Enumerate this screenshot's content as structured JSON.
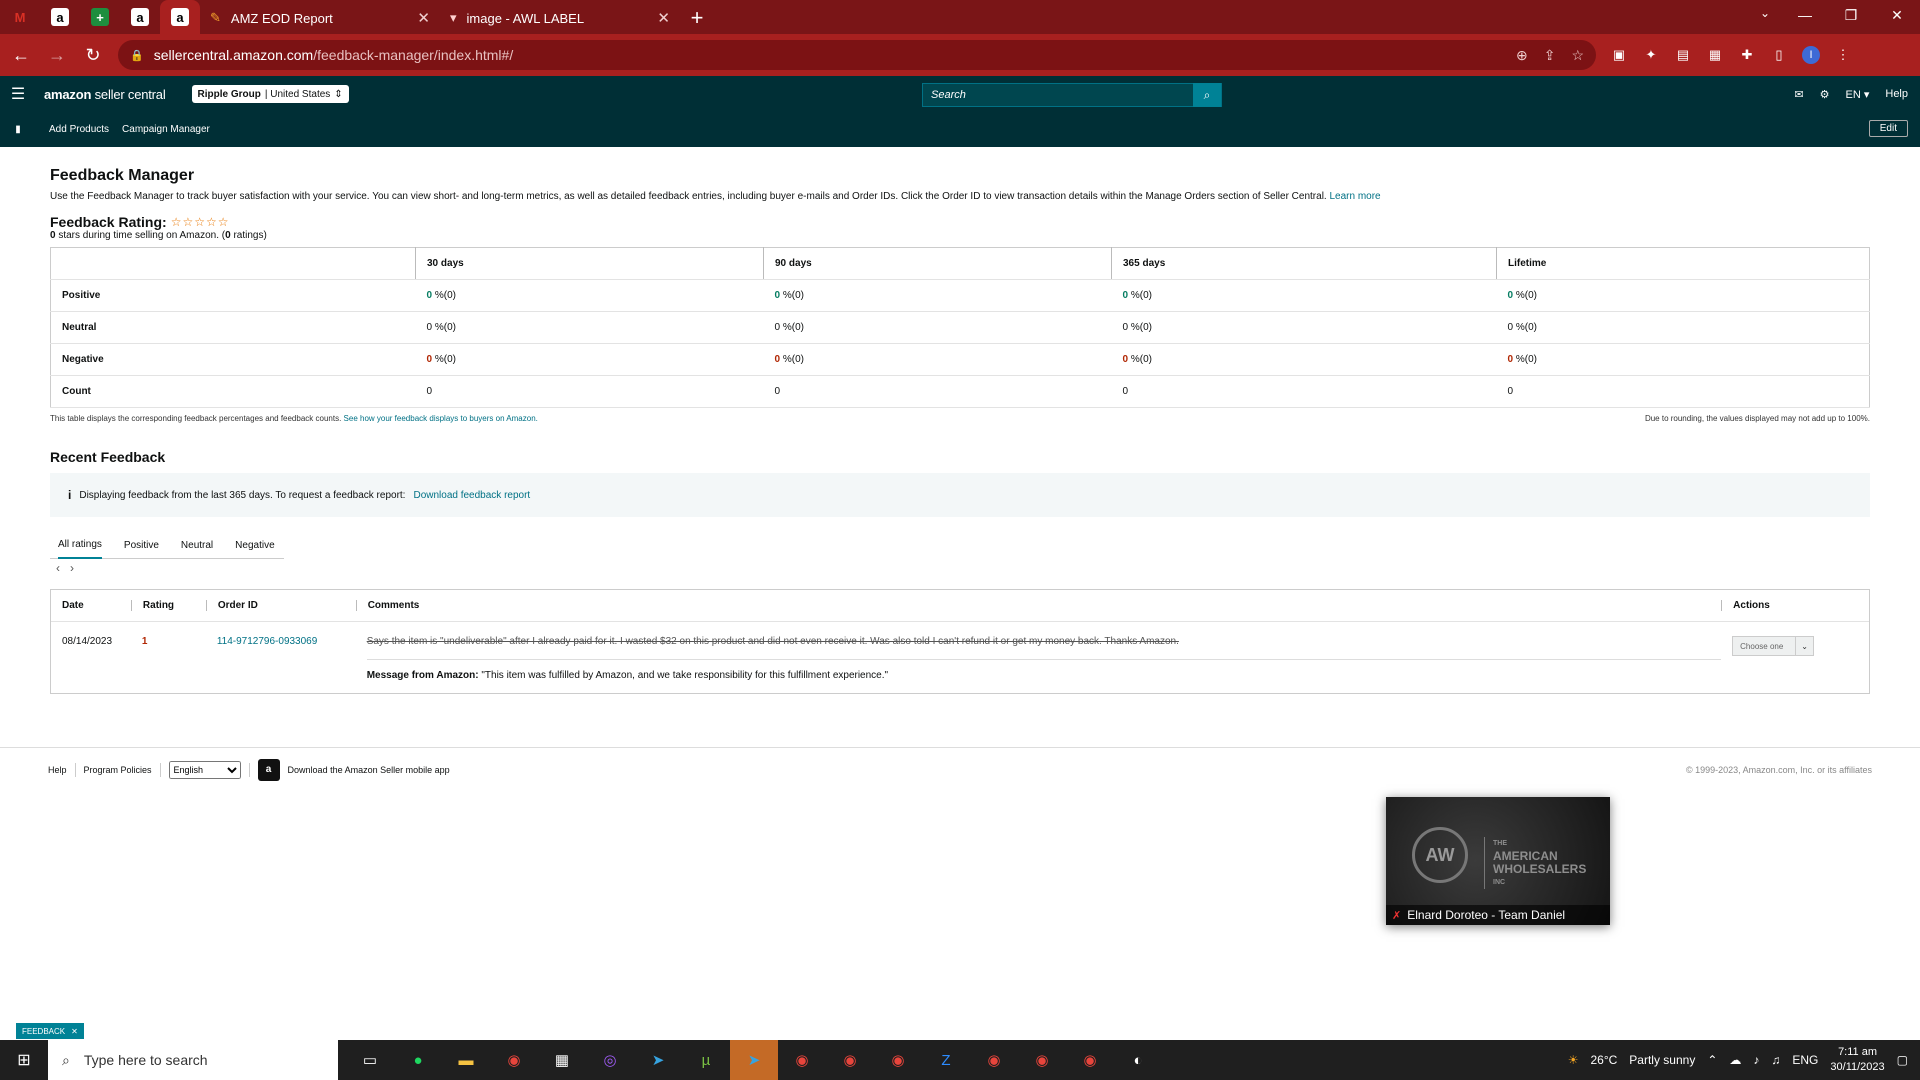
{
  "browser": {
    "pinned_tabs": [
      {
        "icon": "gmail-icon",
        "glyph": "M",
        "color": "#d93025",
        "bg": "transparent"
      },
      {
        "icon": "amazon-icon",
        "glyph": "a",
        "color": "#000",
        "bg": "#fff"
      },
      {
        "icon": "sheets-icon",
        "glyph": "+",
        "color": "#fff",
        "bg": "#1e8e3e"
      },
      {
        "icon": "amazon-icon",
        "glyph": "a",
        "color": "#000",
        "bg": "#fff"
      },
      {
        "icon": "amazon-icon",
        "glyph": "a",
        "color": "#000",
        "bg": "#fff"
      }
    ],
    "tabs": [
      {
        "title": "AMZ EOD Report",
        "active": false
      },
      {
        "title": "image - AWL LABEL",
        "active": false
      }
    ],
    "url_host": "sellercentral.amazon.com",
    "url_path": "/feedback-manager/index.html#/"
  },
  "header": {
    "logo_a": "amazon",
    "logo_b": "seller central",
    "account_name": "Ripple Group",
    "account_region": "| United States",
    "search_placeholder": "Search",
    "lang": "EN",
    "help": "Help"
  },
  "subnav": {
    "items": [
      "Add Products",
      "Campaign Manager"
    ],
    "edit": "Edit"
  },
  "main": {
    "title": "Feedback Manager",
    "intro": "Use the Feedback Manager to track buyer satisfaction with your service. You can view short- and long-term metrics, as well as detailed feedback entries, including buyer e-mails and Order IDs. Click the Order ID to view transaction details within the Manage Orders section of Seller Central.",
    "learn_more": "Learn more",
    "rating_label": "Feedback Rating:",
    "stars": "☆☆☆☆☆",
    "rating_stars_num": "0",
    "rating_sub_a": "stars during time selling on Amazon. (",
    "rating_count": "0",
    "rating_sub_b": "ratings)",
    "metrics": {
      "headers": [
        "30 days",
        "90 days",
        "365 days",
        "Lifetime"
      ],
      "rows": [
        {
          "label": "Positive",
          "cells": [
            [
              "0",
              " %(0)"
            ],
            [
              "0",
              " %(0)"
            ],
            [
              "0",
              " %(0)"
            ],
            [
              "0",
              " %(0)"
            ]
          ],
          "class": "pos"
        },
        {
          "label": "Neutral",
          "cells": [
            [
              "0",
              " %(0)"
            ],
            [
              "0",
              " %(0)"
            ],
            [
              "0",
              " %(0)"
            ],
            [
              "0",
              " %(0)"
            ]
          ],
          "class": ""
        },
        {
          "label": "Negative",
          "cells": [
            [
              "0",
              " %(0)"
            ],
            [
              "0",
              " %(0)"
            ],
            [
              "0",
              " %(0)"
            ],
            [
              "0",
              " %(0)"
            ]
          ],
          "class": "neg"
        },
        {
          "label": "Count",
          "cells": [
            [
              "",
              "0"
            ],
            [
              "",
              "0"
            ],
            [
              "",
              "0"
            ],
            [
              "",
              "0"
            ]
          ],
          "class": ""
        }
      ]
    },
    "note_left": "This table displays the corresponding feedback percentages and feedback counts.",
    "note_link": "See how your feedback displays to buyers on Amazon.",
    "note_right": "Due to rounding, the values displayed may not add up to 100%.",
    "recent_title": "Recent Feedback",
    "info_text": "Displaying feedback from the last 365 days. To request a feedback report:",
    "info_link": "Download feedback report",
    "filter_tabs": [
      "All ratings",
      "Positive",
      "Neutral",
      "Negative"
    ],
    "feedback_headers": {
      "date": "Date",
      "rating": "Rating",
      "order": "Order ID",
      "comments": "Comments",
      "actions": "Actions"
    },
    "feedback": {
      "date": "08/14/2023",
      "rating": "1",
      "order_id": "114-9712796-0933069",
      "comment": "Says the item is \"undeliverable\" after I already paid for it. I wasted $32 on this product and did not even receive it. Was also told I can't refund it or get my money back. Thanks Amazon.",
      "message_label": "Message from Amazon:",
      "message": "\"This item was fulfilled by Amazon, and we take responsibility for this fulfillment experience.\"",
      "action_label": "Choose one"
    }
  },
  "footer": {
    "help": "Help",
    "policies": "Program Policies",
    "language": "English",
    "app": "Download the Amazon Seller mobile app",
    "copyright": "© 1999-2023, Amazon.com, Inc. or its affiliates"
  },
  "video": {
    "logo": "AW",
    "brand_small": "THE",
    "brand_1": "AMERICAN",
    "brand_2": "WHOLESALERS",
    "brand_small2": "INC",
    "caption": "Elnard Doroteo - Team Daniel"
  },
  "feedback_tab": "FEEDBACK",
  "taskbar": {
    "search_placeholder": "Type here to search",
    "temp": "26°C",
    "weather": "Partly sunny",
    "lang": "ENG",
    "time": "7:11 am",
    "date": "30/11/2023"
  }
}
